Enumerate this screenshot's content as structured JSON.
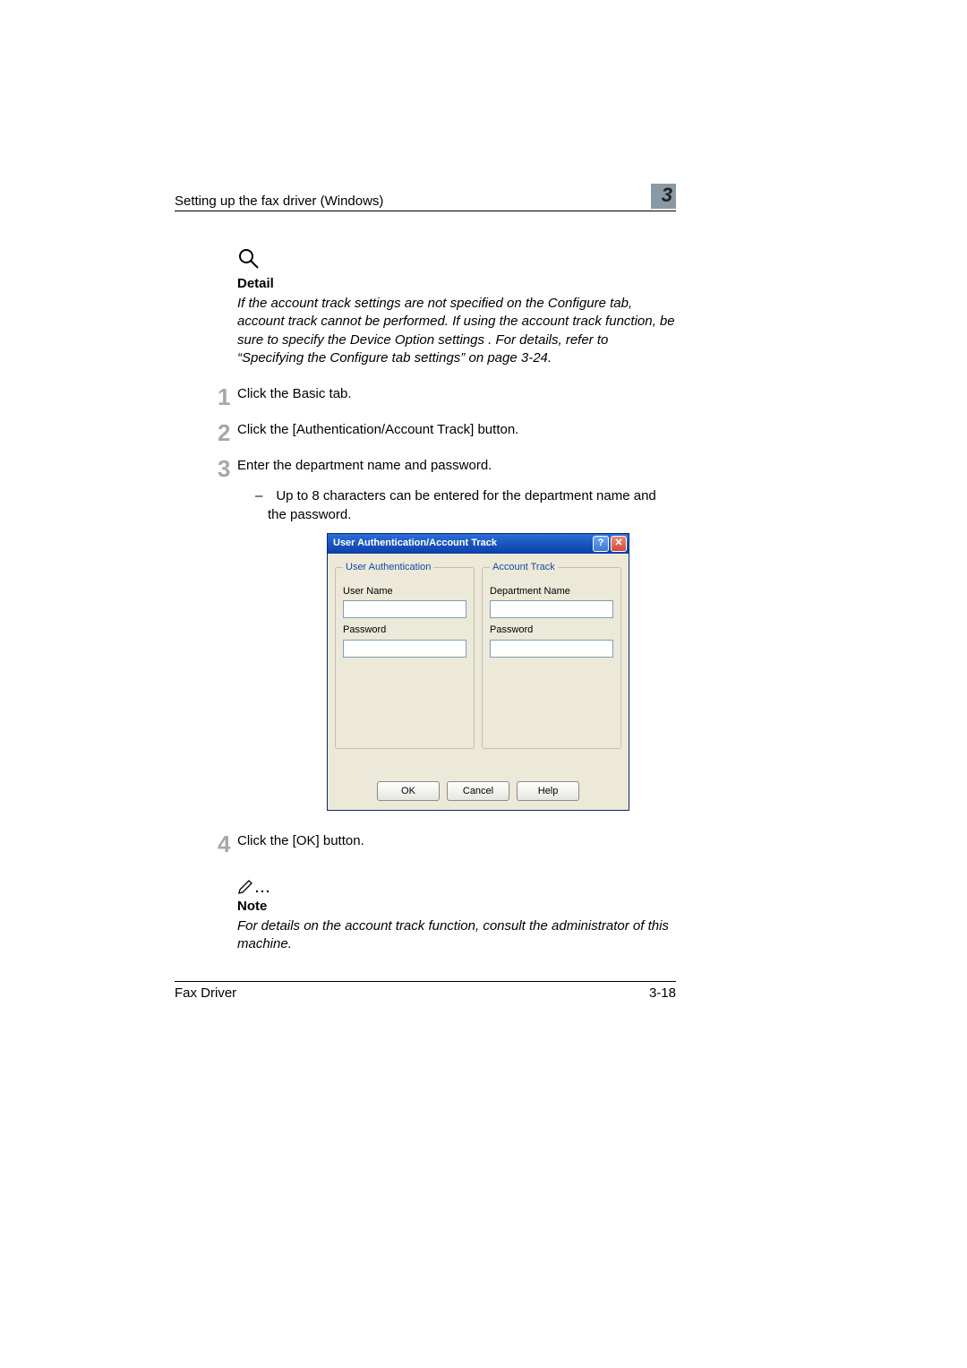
{
  "header": {
    "running_title": "Setting up the fax driver (Windows)",
    "chapter_number": "3"
  },
  "detail": {
    "title": "Detail",
    "text": "If the account track settings are not specified on the Configure tab, account track cannot be performed. If using the account track function, be sure to specify the Device Option settings . For details, refer to “Specifying the Configure tab settings” on page 3-24."
  },
  "steps": [
    {
      "n": "1",
      "text": "Click the Basic tab."
    },
    {
      "n": "2",
      "text": "Click the [Authentication/Account Track] button."
    },
    {
      "n": "3",
      "text": "Enter the department name and password.",
      "sub": "– Up to 8 characters can be entered for the department name and the password."
    },
    {
      "n": "4",
      "text": "Click the [OK] button."
    }
  ],
  "dialog": {
    "title": "User Authentication/Account Track",
    "help_glyph": "?",
    "close_glyph": "✕",
    "groups": {
      "user_auth": {
        "legend": "User Authentication",
        "username_label": "User Name",
        "username_value": "",
        "password_label": "Password",
        "password_value": ""
      },
      "account_track": {
        "legend": "Account Track",
        "department_label": "Department Name",
        "department_value": "",
        "password_label": "Password",
        "password_value": ""
      }
    },
    "buttons": {
      "ok": "OK",
      "cancel": "Cancel",
      "help": "Help"
    }
  },
  "note": {
    "title": "Note",
    "text": "For details on the account track function, consult the administrator of this machine."
  },
  "footer": {
    "left": "Fax Driver",
    "right": "3-18"
  }
}
